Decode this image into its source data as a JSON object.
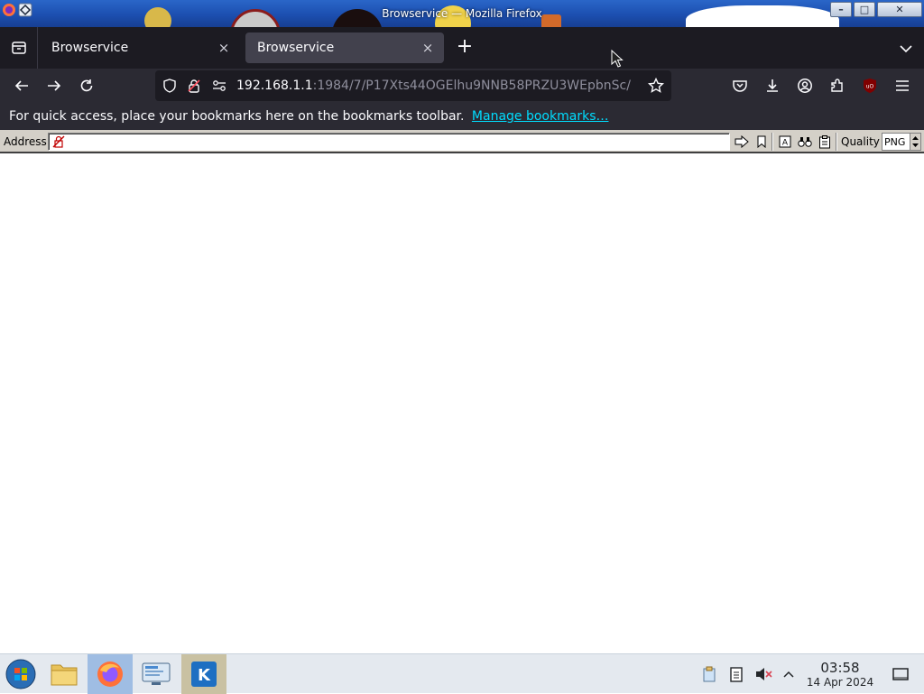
{
  "window": {
    "title": "Browservice — Mozilla Firefox",
    "controls": {
      "minimize": "–",
      "maximize": "□",
      "close": "✕"
    }
  },
  "tabs": [
    {
      "label": "Browservice",
      "active": false,
      "close": "×"
    },
    {
      "label": "Browservice",
      "active": true,
      "close": "×"
    }
  ],
  "tabstrip": {
    "new_tab": "+"
  },
  "urlbar": {
    "host": "192.168.1.1",
    "rest": ":1984/7/P17Xts44OGElhu9NNB58PRZU3WEpbnSc/"
  },
  "bookmarks_bar": {
    "message": "For quick access, place your bookmarks here on the bookmarks toolbar.",
    "link": "Manage bookmarks…"
  },
  "browservice_toolbar": {
    "address_label": "Address",
    "address_value": "",
    "quality_label": "Quality",
    "quality_value": "PNG"
  },
  "clock": {
    "time": "03:58",
    "date": "14 Apr 2024"
  },
  "colors": {
    "tabstrip_bg": "#1c1b22",
    "toolbar_bg": "#2b2a33",
    "link": "#00ddff",
    "taskbar_bg": "#e4e9ef",
    "active_task": "#9fbde3"
  }
}
